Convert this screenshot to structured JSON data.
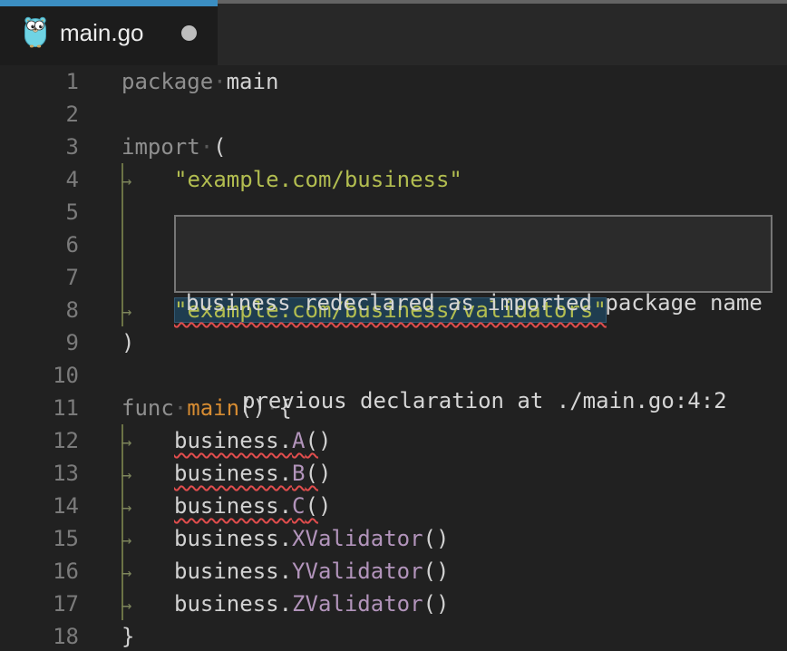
{
  "tab": {
    "title": "main.go",
    "icon": "go-gopher-icon",
    "modified": true
  },
  "tooltip": {
    "line1": "business redeclared as imported package name",
    "line2": "previous declaration at ./main.go:4:2"
  },
  "colors": {
    "accent_blue": "#3b8ec2",
    "editor_bg": "#212121",
    "tabbar_bg": "#282828",
    "tab_bg": "#1c1c1c",
    "tooltip_bg": "#2b2b2b",
    "tooltip_border": "#767676",
    "keyword": "#8f8f8f",
    "plain": "#d2d2d2",
    "string": "#b2bd50",
    "function": "#d78c32",
    "member": "#b294bb",
    "line_number": "#7b7b7b",
    "indent_guide": "#6b7245",
    "error_squiggle": "#e14d4d",
    "string_highlight_bg": "#1f3d50"
  },
  "editor": {
    "tab_arrow": "→",
    "whitespace_dot": "·",
    "lines": [
      {
        "n": "1",
        "segs": [
          {
            "t": "kw",
            "x": "package"
          },
          {
            "t": "ws",
            "x": "·"
          },
          {
            "t": "plain",
            "x": "main"
          }
        ]
      },
      {
        "n": "2",
        "segs": []
      },
      {
        "n": "3",
        "segs": [
          {
            "t": "kw",
            "x": "import"
          },
          {
            "t": "ws",
            "x": "·"
          },
          {
            "t": "plain",
            "x": "("
          }
        ]
      },
      {
        "n": "4",
        "segs": [
          {
            "t": "tab"
          },
          {
            "t": "str",
            "x": "\"example.com/business\""
          }
        ]
      },
      {
        "n": "5",
        "segs": []
      },
      {
        "n": "6",
        "segs": []
      },
      {
        "n": "7",
        "segs": []
      },
      {
        "n": "8",
        "segs": [
          {
            "t": "tab"
          },
          {
            "wrap": [
              "hl",
              "sq"
            ],
            "segs": [
              {
                "t": "str",
                "x": "\"example.com/business/validators\""
              }
            ]
          }
        ]
      },
      {
        "n": "9",
        "segs": [
          {
            "t": "plain",
            "x": ")"
          }
        ]
      },
      {
        "n": "10",
        "segs": []
      },
      {
        "n": "11",
        "segs": [
          {
            "t": "kw",
            "x": "func"
          },
          {
            "t": "ws",
            "x": "·"
          },
          {
            "t": "fn",
            "x": "main"
          },
          {
            "t": "plain",
            "x": "()"
          },
          {
            "t": "ws",
            "x": "·"
          },
          {
            "t": "plain",
            "x": "{"
          }
        ]
      },
      {
        "n": "12",
        "segs": [
          {
            "t": "tab"
          },
          {
            "wrap": [
              "sq"
            ],
            "segs": [
              {
                "t": "plain",
                "x": "business."
              },
              {
                "t": "member",
                "x": "A"
              },
              {
                "t": "plain",
                "x": "("
              }
            ]
          },
          {
            "t": "plain",
            "x": ")"
          }
        ]
      },
      {
        "n": "13",
        "segs": [
          {
            "t": "tab"
          },
          {
            "wrap": [
              "sq"
            ],
            "segs": [
              {
                "t": "plain",
                "x": "business."
              },
              {
                "t": "member",
                "x": "B"
              },
              {
                "t": "plain",
                "x": "("
              }
            ]
          },
          {
            "t": "plain",
            "x": ")"
          }
        ]
      },
      {
        "n": "14",
        "segs": [
          {
            "t": "tab"
          },
          {
            "wrap": [
              "sq"
            ],
            "segs": [
              {
                "t": "plain",
                "x": "business."
              },
              {
                "t": "member",
                "x": "C"
              },
              {
                "t": "plain",
                "x": "("
              }
            ]
          },
          {
            "t": "plain",
            "x": ")"
          }
        ]
      },
      {
        "n": "15",
        "segs": [
          {
            "t": "tab"
          },
          {
            "t": "plain",
            "x": "business."
          },
          {
            "t": "member",
            "x": "XValidator"
          },
          {
            "t": "plain",
            "x": "()"
          }
        ]
      },
      {
        "n": "16",
        "segs": [
          {
            "t": "tab"
          },
          {
            "t": "plain",
            "x": "business."
          },
          {
            "t": "member",
            "x": "YValidator"
          },
          {
            "t": "plain",
            "x": "()"
          }
        ]
      },
      {
        "n": "17",
        "segs": [
          {
            "t": "tab"
          },
          {
            "t": "plain",
            "x": "business."
          },
          {
            "t": "member",
            "x": "ZValidator"
          },
          {
            "t": "plain",
            "x": "()"
          }
        ]
      },
      {
        "n": "18",
        "segs": [
          {
            "t": "plain",
            "x": "}"
          }
        ]
      }
    ]
  }
}
